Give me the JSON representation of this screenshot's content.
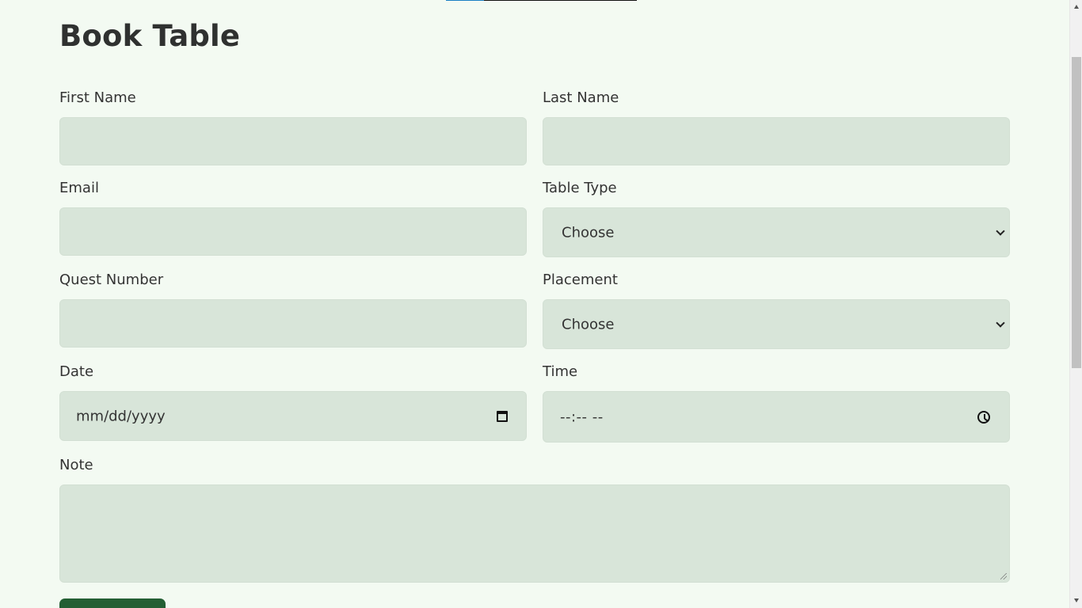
{
  "page": {
    "title": "Book Table"
  },
  "form": {
    "first_name_label": "First Name",
    "last_name_label": "Last Name",
    "email_label": "Email",
    "table_type_label": "Table Type",
    "quest_number_label": "Quest Number",
    "placement_label": "Placement",
    "date_label": "Date",
    "time_label": "Time",
    "note_label": "Note",
    "table_type_value": "Choose",
    "placement_value": "Choose",
    "date_placeholder": "mm/dd/yyyy",
    "time_placeholder": "--:-- --"
  },
  "icons": {
    "select_arrow": "chevron-down-icon",
    "date": "calendar-icon",
    "time": "clock-icon"
  },
  "colors": {
    "background": "#f3faf2",
    "input": "#d8e5d9",
    "button": "#245f34",
    "text": "#2f3130"
  }
}
